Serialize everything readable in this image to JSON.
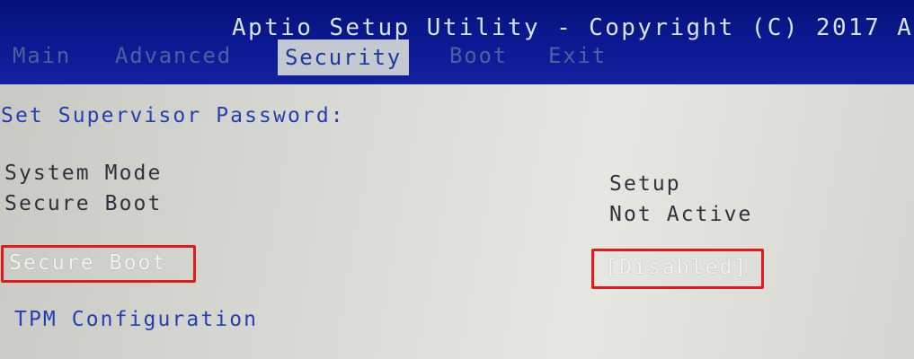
{
  "window": {
    "title": "Aptio Setup Utility - Copyright (C) 2017 A"
  },
  "tabs": [
    {
      "label": "Main",
      "active": false
    },
    {
      "label": "Advanced",
      "active": false
    },
    {
      "label": "Security",
      "active": true
    },
    {
      "label": "Boot",
      "active": false
    },
    {
      "label": "Exit",
      "active": false
    }
  ],
  "security": {
    "supervisor_password_label": "Set Supervisor Password:",
    "system_mode_label": "System Mode",
    "system_mode_value": "Setup",
    "secure_boot_status_label": "Secure Boot",
    "secure_boot_status_value": "Not Active",
    "secure_boot_option_label": "Secure Boot",
    "secure_boot_option_value": "[Disabled]",
    "tpm_configuration_label": "TPM Configuration"
  },
  "colors": {
    "header_background": "#0a1a93",
    "highlight_border": "#e81818",
    "link_text": "#233fb4"
  }
}
